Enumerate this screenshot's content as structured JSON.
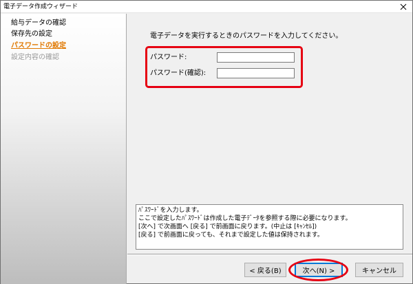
{
  "window": {
    "title": "電子データ作成ウィザード"
  },
  "steps": [
    {
      "label": "給与データの確認",
      "state": "done"
    },
    {
      "label": "保存先の設定",
      "state": "done"
    },
    {
      "label": "パスワードの設定",
      "state": "current"
    },
    {
      "label": "設定内容の確認",
      "state": "pending"
    }
  ],
  "main": {
    "instruction": "電子データを実行するときのパスワードを入力してください。",
    "password_label": "パスワード:",
    "password_value": "",
    "confirm_label": "パスワード(確認):",
    "confirm_value": ""
  },
  "help": {
    "lines": [
      "ﾊﾟｽﾜｰﾄﾞを入力します。",
      "ここで設定したﾊﾟｽﾜｰﾄﾞは作成した電子ﾃﾞｰﾀを参照する際に必要になります。",
      "[次へ] で次画面へ [戻る] で前画面に戻ります。(中止は [ｷｬﾝｾﾙ])",
      "[戻る] で前画面に戻っても、それまで設定した値は保持されます。"
    ]
  },
  "buttons": {
    "back": "< 戻る(B)",
    "next": "次へ(N) >",
    "cancel": "キャンセル"
  },
  "colors": {
    "highlight": "#e60012",
    "current_step": "#e07800",
    "pending_step": "#9a9a9a"
  }
}
